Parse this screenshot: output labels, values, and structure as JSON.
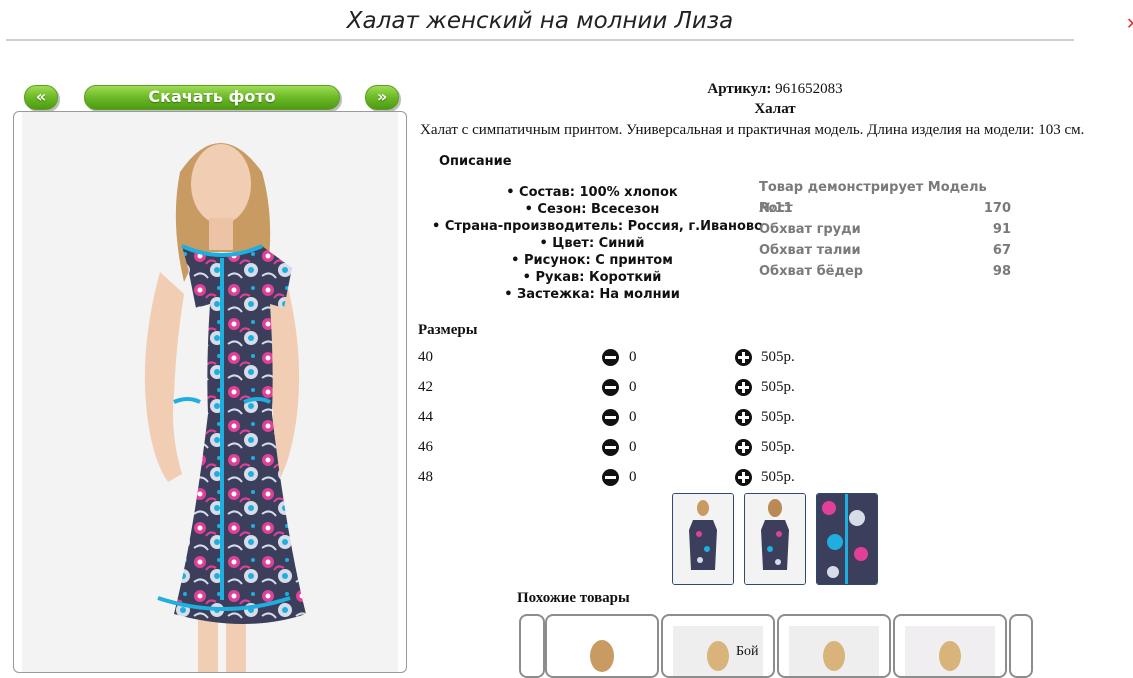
{
  "title": "Халат женский на молнии Лиза",
  "nav": {
    "prev_label": "«",
    "download_label": "Скачать фото",
    "next_label": "»"
  },
  "product": {
    "article_label": "Артикул:",
    "article_value": "961652083",
    "type": "Халат",
    "description": "Халат с симпатичным принтом. Универсальная и практичная модель. Длина изделия на модели: 103 см."
  },
  "description_header": "Описание",
  "properties": [
    "• Состав: 100% хлопок",
    "• Сезон: Всесезон",
    "• Страна-производитель: Россия, г.Иваново",
    "• Цвет: Синий",
    "• Рисунок: С принтом",
    "• Рукав: Короткий",
    "• Застежка: На молнии"
  ],
  "model_params": [
    {
      "label": "Товар демонстрирует Модель №11",
      "value": ""
    },
    {
      "label": "Рост",
      "value": "170"
    },
    {
      "label": "Обхват груди",
      "value": "91"
    },
    {
      "label": "Обхват талии",
      "value": "67"
    },
    {
      "label": "Обхват бёдер",
      "value": "98"
    }
  ],
  "sizes_header": "Размеры",
  "sizes": [
    {
      "size": "40",
      "qty": "0",
      "price": "505р."
    },
    {
      "size": "42",
      "qty": "0",
      "price": "505р."
    },
    {
      "size": "44",
      "qty": "0",
      "price": "505р."
    },
    {
      "size": "46",
      "qty": "0",
      "price": "505р."
    },
    {
      "size": "48",
      "qty": "0",
      "price": "505р."
    }
  ],
  "similar_header": "Похожие товары",
  "similar_partial_label": "Бой",
  "colors": {
    "accent_green": "#6bb926",
    "dress_navy": "#3b3f5c",
    "dress_pink": "#e0409a",
    "dress_turquoise": "#1eaee0",
    "model_info_gray": "#7a7a7a"
  }
}
